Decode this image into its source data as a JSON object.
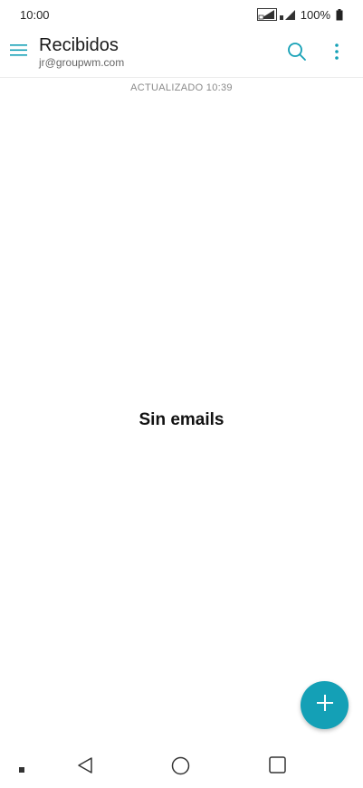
{
  "status_bar": {
    "time": "10:00",
    "battery_percent": "100%",
    "icons": [
      "signal-icon",
      "signal-icon",
      "battery-icon"
    ]
  },
  "app_bar": {
    "title": "Recibidos",
    "account": "jr@groupwm.com",
    "icons": [
      "menu-icon",
      "search-icon",
      "more-vert-icon"
    ]
  },
  "inbox": {
    "updated_label": "ACTUALIZADO 10:39",
    "empty_message": "Sin emails"
  },
  "fab": {
    "icon": "plus-icon",
    "color": "#14a0b6"
  },
  "colors": {
    "accent": "#14a0b6"
  },
  "nav_bar": {
    "icons": [
      "square-small-icon",
      "back-icon",
      "home-icon",
      "recents-icon"
    ]
  }
}
